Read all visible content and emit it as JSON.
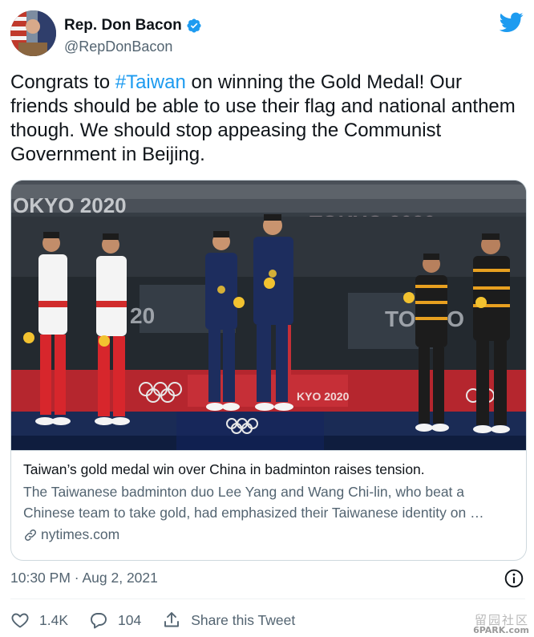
{
  "author": {
    "name": "Rep. Don Bacon",
    "handle": "@RepDonBacon",
    "verified": true,
    "avatar_icon": "avatar-photo"
  },
  "tweet": {
    "text_before": "Congrats to ",
    "hashtag": "#Taiwan",
    "text_after": " on winning the Gold Medal! Our friends should be able to use their flag and national anthem though. We should stop appeasing the Communist Government in Beijing."
  },
  "card": {
    "image_text": {
      "banner_left": "OKYO 2020",
      "banner_mid": "TOKYO 2020",
      "board_left": "20",
      "board_right": "TOKYO",
      "board_center": "KYO 2020"
    },
    "title": "Taiwan’s gold medal win over China in badminton raises tension.",
    "description": "The Taiwanese badminton duo Lee Yang and Wang Chi-lin, who beat a Chinese team to take gold, had emphasized their Taiwanese identity on …",
    "domain": "nytimes.com"
  },
  "timestamp": "10:30 PM · Aug 2, 2021",
  "actions": {
    "likes": "1.4K",
    "replies": "104",
    "share_label": "Share this Tweet"
  },
  "watermark": {
    "line1": "留园社区",
    "line2": "6PARK.com"
  },
  "colors": {
    "accent": "#1d9bf0",
    "text": "#0f1419",
    "secondary": "#536471",
    "border": "#cfd9de"
  }
}
